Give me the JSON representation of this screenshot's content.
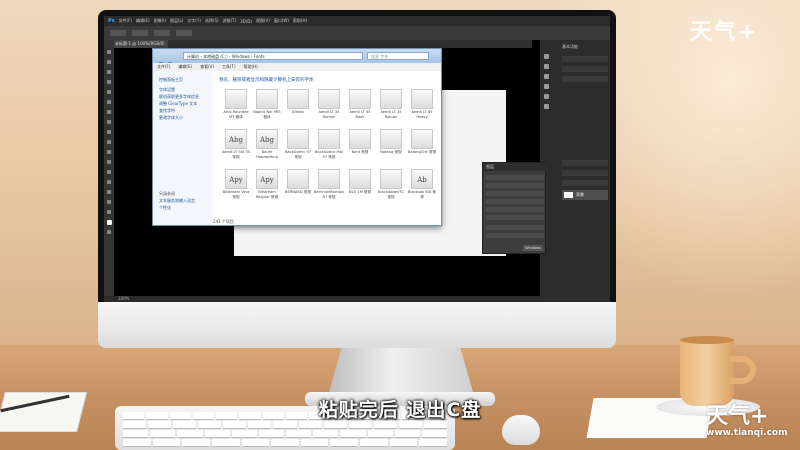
{
  "photoshop": {
    "logo": "Ps",
    "menu": [
      "文件(F)",
      "编辑(E)",
      "图像(I)",
      "图层(L)",
      "文字(Y)",
      "选择(S)",
      "滤镜(T)",
      "3D(D)",
      "视图(V)",
      "窗口(W)",
      "帮助(H)"
    ],
    "tab_label": "未标题-1 @ 100%(RGB/8)",
    "status_text": "100%",
    "right_panel_header": "基本功能",
    "layer_label": "背景",
    "float_panel_title": "图层",
    "float_panel_button": "Windows"
  },
  "explorer": {
    "address": "计算机 › 本地磁盘 (C:) › Windows › Fonts",
    "search_placeholder": "搜索 字体",
    "menu": [
      "文件(F)",
      "编辑(E)",
      "查看(V)",
      "工具(T)",
      "帮助(H)"
    ],
    "heading": "预览、删除或者显示和隐藏计算机上安装的字体",
    "sidebar": [
      "控制面板主页",
      "字体设置",
      "联机获取更多字体信息",
      "调整 ClearType 文本",
      "查找字符",
      "更改字体大小"
    ],
    "sidebar_bottom": [
      "另请参阅",
      "文本服务和输入语言",
      "个性化"
    ],
    "fonts": [
      {
        "glyph": "",
        "label": "Arial Rounded MT 粗体"
      },
      {
        "glyph": "",
        "label": "Baphis Nel 9R5 粗体"
      },
      {
        "glyph": "",
        "label": "Aflelas"
      },
      {
        "glyph": "",
        "label": "Aemit LT 55 Roman"
      },
      {
        "glyph": "",
        "label": "Aemit LT 45 Book"
      },
      {
        "glyph": "",
        "label": "Aemit LT 35 Roman"
      },
      {
        "glyph": "",
        "label": "Aemit LT 85 Heavy"
      },
      {
        "glyph": "Abg",
        "label": "Aemit LT Std 55 常规"
      },
      {
        "glyph": "Abg",
        "label": "Bauer Handwriting"
      },
      {
        "glyph": "",
        "label": "BackGothic 97 常规"
      },
      {
        "glyph": "",
        "label": "BackGothic Mbl 97 常规"
      },
      {
        "glyph": "",
        "label": "Bard 常规"
      },
      {
        "glyph": "",
        "label": "Batang 常规"
      },
      {
        "glyph": "",
        "label": "BatangChe 常规"
      },
      {
        "glyph": "Apy",
        "label": "Bitstream Vera 常规"
      },
      {
        "glyph": "Apy",
        "label": "Bitstream Regular 常规"
      },
      {
        "glyph": "",
        "label": "BERNARD 常规"
      },
      {
        "glyph": "",
        "label": "BernhardFashion BT 常规"
      },
      {
        "glyph": "",
        "label": "BLO 2M 常规"
      },
      {
        "glyph": "",
        "label": "BlackAdderITC 常规"
      },
      {
        "glyph": "Ab",
        "label": "Blackoak Std 常规"
      }
    ],
    "status": "241 个项目"
  },
  "subtitle": "粘贴完后 退出C盘",
  "watermark": {
    "brand": "天气+",
    "url": "www.tianqi.com"
  }
}
